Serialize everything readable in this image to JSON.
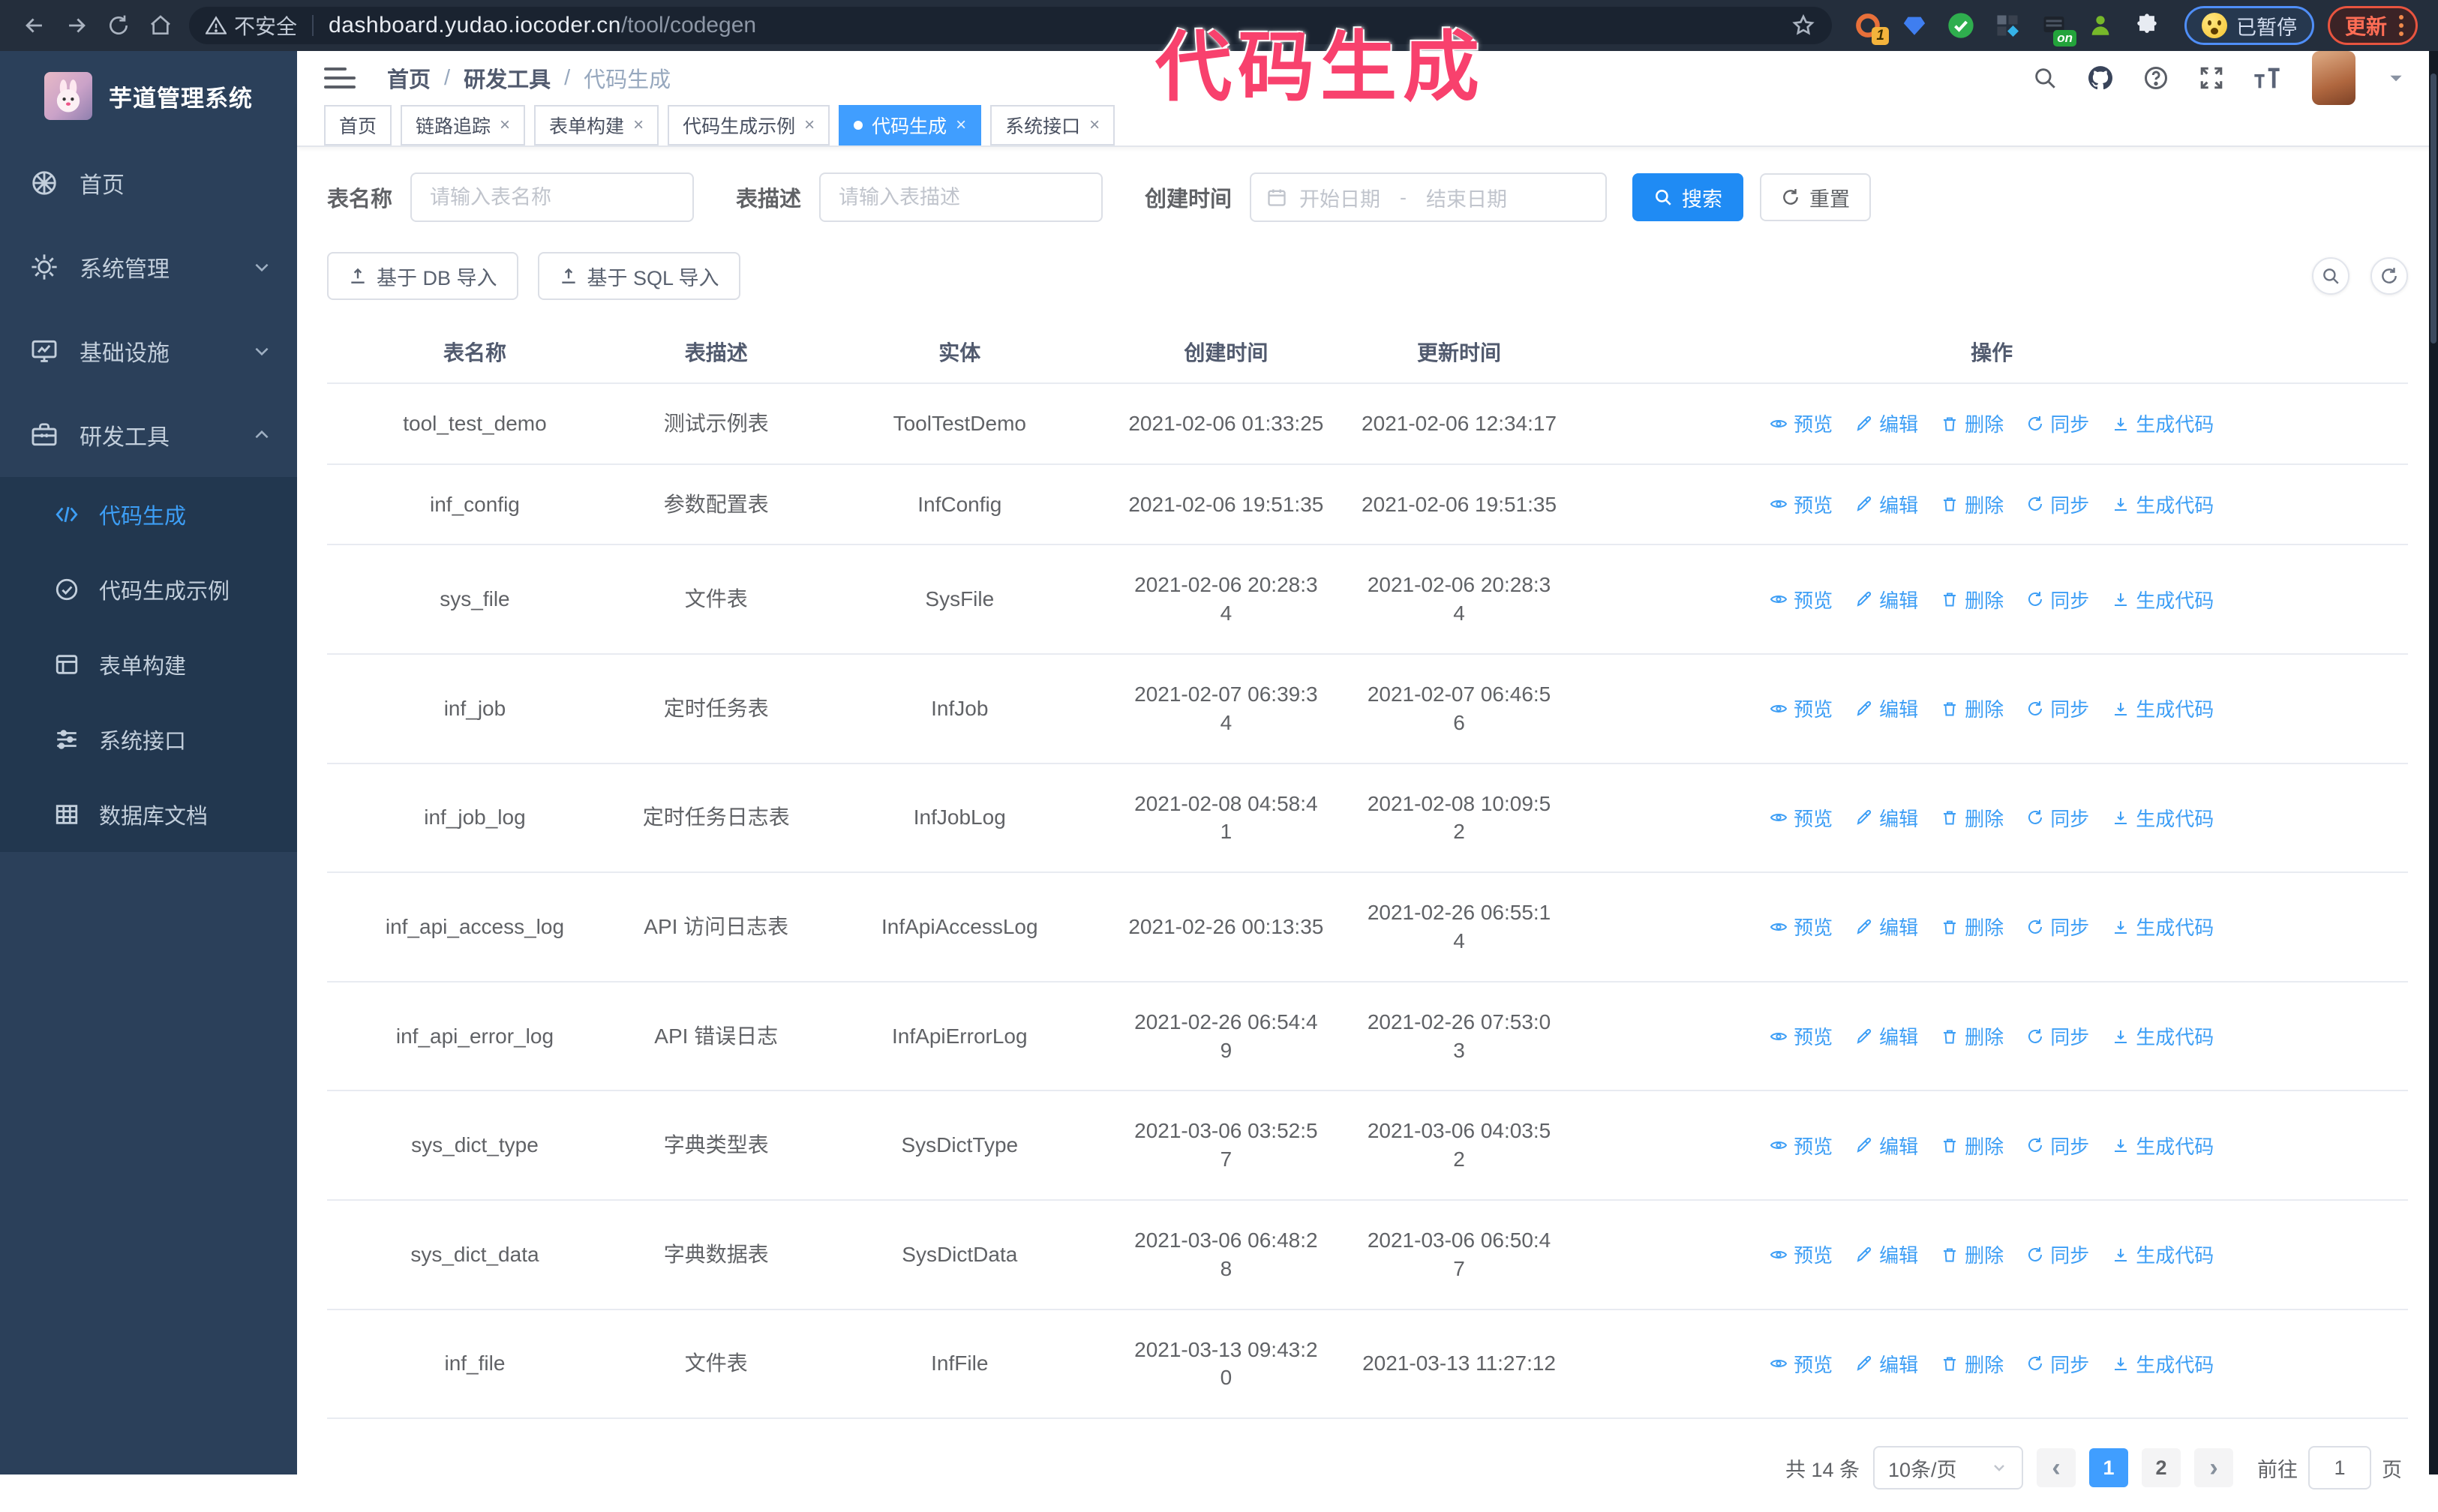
{
  "browser": {
    "security_label": "不安全",
    "url_host": "dashboard.yudao.iocoder.cn",
    "url_path": "/tool/codegen",
    "ext_badge_1": "1",
    "ext_badge_on": "on",
    "paused_badge": "已暂停",
    "update_label": "更新"
  },
  "overlay": {
    "title": "代码生成",
    "color": "#f8416d"
  },
  "sidebar": {
    "logo_title": "芋道管理系统",
    "items": [
      {
        "label": "首页"
      },
      {
        "label": "系统管理"
      },
      {
        "label": "基础设施"
      },
      {
        "label": "研发工具"
      }
    ],
    "subitems": [
      {
        "label": "代码生成"
      },
      {
        "label": "代码生成示例"
      },
      {
        "label": "表单构建"
      },
      {
        "label": "系统接口"
      },
      {
        "label": "数据库文档"
      }
    ]
  },
  "header": {
    "breadcrumb": {
      "home": "首页",
      "group": "研发工具",
      "current": "代码生成"
    }
  },
  "tabs": [
    {
      "label": "首页"
    },
    {
      "label": "链路追踪"
    },
    {
      "label": "表单构建"
    },
    {
      "label": "代码生成示例"
    },
    {
      "label": "代码生成"
    },
    {
      "label": "系统接口"
    }
  ],
  "filters": {
    "table_name_label": "表名称",
    "table_name_placeholder": "请输入表名称",
    "table_desc_label": "表描述",
    "table_desc_placeholder": "请输入表描述",
    "create_time_label": "创建时间",
    "date_start_placeholder": "开始日期",
    "date_separator": "-",
    "date_end_placeholder": "结束日期",
    "search_label": "搜索",
    "reset_label": "重置"
  },
  "toolbar": {
    "import_db_label": "基于 DB 导入",
    "import_sql_label": "基于 SQL 导入"
  },
  "table": {
    "columns": [
      "表名称",
      "表描述",
      "实体",
      "创建时间",
      "更新时间",
      "操作"
    ],
    "actions": [
      "预览",
      "编辑",
      "删除",
      "同步",
      "生成代码"
    ],
    "rows": [
      {
        "name": "tool_test_demo",
        "desc": "测试示例表",
        "entity": "ToolTestDemo",
        "created": "2021-02-06 01:33:25",
        "updated": "2021-02-06 12:34:17"
      },
      {
        "name": "inf_config",
        "desc": "参数配置表",
        "entity": "InfConfig",
        "created": "2021-02-06 19:51:35",
        "updated": "2021-02-06 19:51:35"
      },
      {
        "name": "sys_file",
        "desc": "文件表",
        "entity": "SysFile",
        "created": "2021-02-06 20:28:3\n4",
        "updated": "2021-02-06 20:28:3\n4"
      },
      {
        "name": "inf_job",
        "desc": "定时任务表",
        "entity": "InfJob",
        "created": "2021-02-07 06:39:3\n4",
        "updated": "2021-02-07 06:46:5\n6"
      },
      {
        "name": "inf_job_log",
        "desc": "定时任务日志表",
        "entity": "InfJobLog",
        "created": "2021-02-08 04:58:4\n1",
        "updated": "2021-02-08 10:09:5\n2"
      },
      {
        "name": "inf_api_access_log",
        "desc": "API 访问日志表",
        "entity": "InfApiAccessLog",
        "created": "2021-02-26 00:13:35",
        "updated": "2021-02-26 06:55:1\n4"
      },
      {
        "name": "inf_api_error_log",
        "desc": "API 错误日志",
        "entity": "InfApiErrorLog",
        "created": "2021-02-26 06:54:4\n9",
        "updated": "2021-02-26 07:53:0\n3"
      },
      {
        "name": "sys_dict_type",
        "desc": "字典类型表",
        "entity": "SysDictType",
        "created": "2021-03-06 03:52:5\n7",
        "updated": "2021-03-06 04:03:5\n2"
      },
      {
        "name": "sys_dict_data",
        "desc": "字典数据表",
        "entity": "SysDictData",
        "created": "2021-03-06 06:48:2\n8",
        "updated": "2021-03-06 06:50:4\n7"
      },
      {
        "name": "inf_file",
        "desc": "文件表",
        "entity": "InfFile",
        "created": "2021-03-13 09:43:2\n0",
        "updated": "2021-03-13 11:27:12"
      }
    ]
  },
  "pagination": {
    "total_label": "共 14 条",
    "page_size_label": "10条/页",
    "prev_label": "‹",
    "next_label": "›",
    "pages": [
      "1",
      "2"
    ],
    "goto_label": "前往",
    "goto_value": "1",
    "goto_suffix": "页"
  }
}
